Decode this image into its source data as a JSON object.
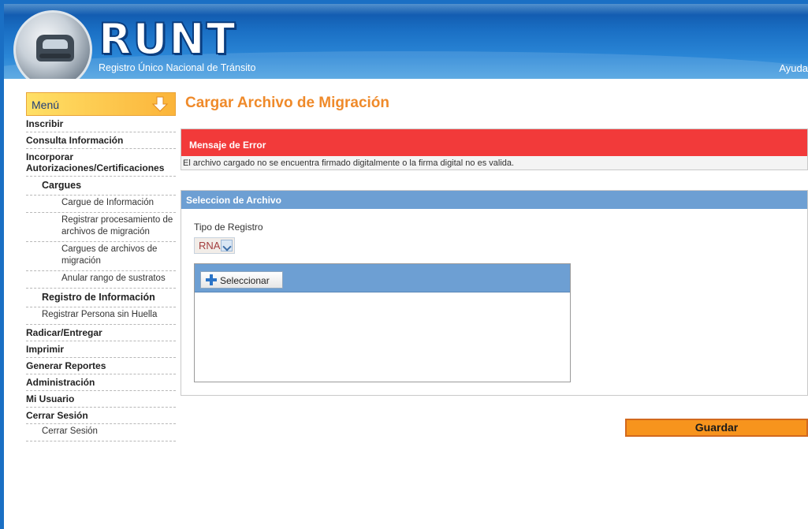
{
  "header": {
    "brand": "RUNT",
    "tagline": "Registro Único Nacional de Tránsito",
    "help": "Ayuda"
  },
  "sidebar": {
    "menu_title": "Menú",
    "items": {
      "inscribir": "Inscribir",
      "consulta": "Consulta Información",
      "incorporar": "Incorporar Autorizaciones/Certificaciones",
      "cargues": "Cargues",
      "cargue_info": "Cargue de Información",
      "registrar_proc": "Registrar procesamiento de archivos de migración",
      "cargues_archivos": "Cargues de archivos de migración",
      "anular": "Anular rango de sustratos",
      "registro_info": "Registro de Información",
      "registrar_persona": "Registrar Persona sin Huella",
      "radicar": "Radicar/Entregar",
      "imprimir": "Imprimir",
      "reportes": "Generar Reportes",
      "admin": "Administración",
      "usuario": "Mi Usuario",
      "cerrar": "Cerrar Sesión",
      "cerrar_sub": "Cerrar Sesión"
    }
  },
  "main": {
    "title": "Cargar Archivo de Migración",
    "error": {
      "heading": "Mensaje de Error",
      "message": "El archivo cargado no se encuentra firmado digitalmente o la firma digital no es valida."
    },
    "selection": {
      "heading": "Seleccion de Archivo",
      "tipo_label": "Tipo de Registro",
      "tipo_value": "RNA",
      "select_button": "Seleccionar"
    },
    "save_button": "Guardar"
  },
  "colors": {
    "header_blue": "#1a6fc4",
    "title_orange": "#ef8a2a",
    "error_red": "#f23a3a",
    "panel_blue": "#6d9fd3",
    "save_orange": "#f7941d"
  },
  "icons": {
    "menu_arrow": "arrow-down-icon",
    "add": "plus-icon",
    "dropdown": "chevron-down-icon",
    "logo": "car-logo-icon"
  }
}
